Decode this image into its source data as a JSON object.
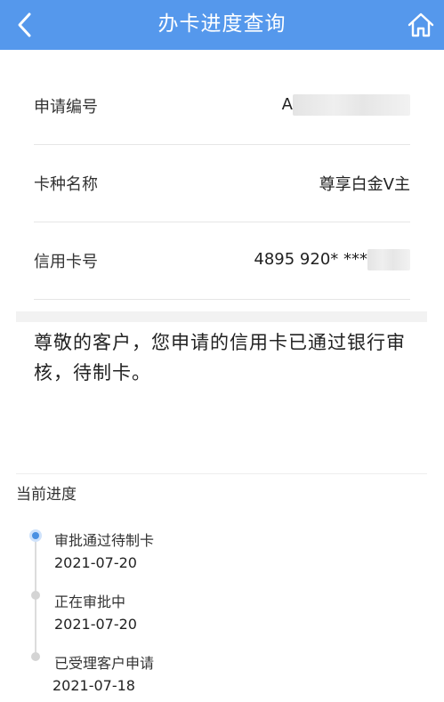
{
  "header": {
    "title": "办卡进度查询",
    "back_icon": "chevron-left-icon",
    "home_icon": "home-icon",
    "background_color": "#5598ec"
  },
  "info": [
    {
      "label": "申请编号",
      "value": "A"
    },
    {
      "label": "卡种名称",
      "value": "尊享白金V主"
    },
    {
      "label": "信用卡号",
      "value": "4895 920* ***"
    }
  ],
  "message": "尊敬的客户，您申请的信用卡已通过银行审核，待制卡。",
  "progress": {
    "title": "当前进度",
    "steps": [
      {
        "status": "审批通过待制卡",
        "date": "2021-07-20",
        "active": true
      },
      {
        "status": "正在审批中",
        "date": "2021-07-20",
        "active": false
      },
      {
        "status": "已受理客户申请",
        "date": "2021-07-18",
        "active": false
      }
    ],
    "active_color": "#4a90e2"
  }
}
